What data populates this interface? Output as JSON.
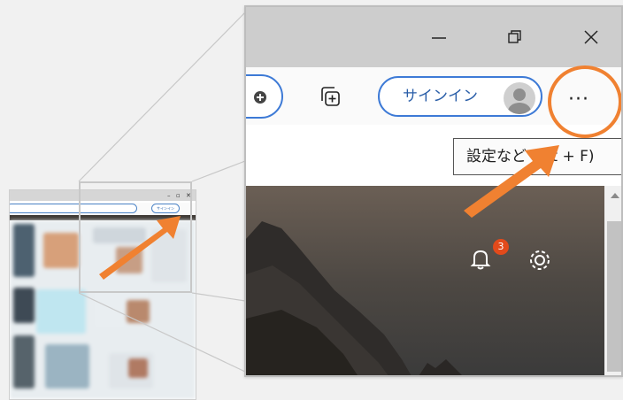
{
  "window_controls": {
    "minimize_icon": "minimize-icon",
    "restore_icon": "restore-icon",
    "close_icon": "close-icon"
  },
  "toolbar": {
    "collections_icon": "collections-icon",
    "signin_label": "サインイン",
    "more_label": "···"
  },
  "tooltip": {
    "text": "設定など (Alt + F)"
  },
  "content": {
    "notification_count": "3",
    "bell_icon": "bell-icon",
    "gear_icon": "gear-icon"
  },
  "thumbnail": {
    "signin_label": "サインイン",
    "window_controls": [
      "–",
      "▫",
      "✕"
    ]
  },
  "colors": {
    "highlight": "#f08131",
    "arrow": "#f08131",
    "accent_border": "#3d7ad6",
    "badge": "#e24a1b"
  }
}
